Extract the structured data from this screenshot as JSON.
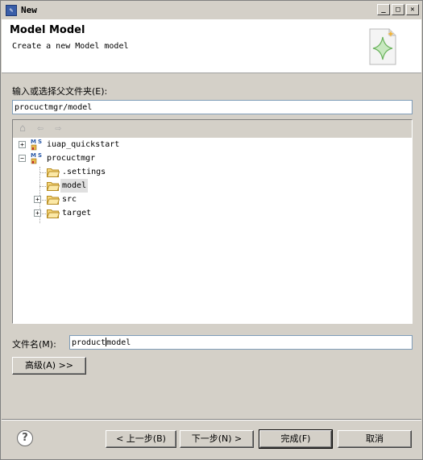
{
  "window": {
    "title": "New",
    "icon": "new-wizard-icon",
    "controls": {
      "minimize": "_",
      "maximize": "□",
      "close": "✕"
    }
  },
  "header": {
    "title": "Model Model",
    "description": "Create a new Model model",
    "icon": "wizard-banner-icon"
  },
  "folder": {
    "label": "输入或选择父文件夹(E):",
    "value": "procuctmgr/model"
  },
  "tree": {
    "toolbar": {
      "home_icon": "home-icon",
      "back_icon": "back-arrow-icon",
      "forward_icon": "forward-arrow-icon"
    },
    "nodes": [
      {
        "label": "iuap_quickstart",
        "type": "project",
        "expander": "+"
      },
      {
        "label": "procuctmgr",
        "type": "project",
        "expander": "−"
      },
      {
        "label": ".settings",
        "type": "folder"
      },
      {
        "label": "model",
        "type": "folder",
        "selected": true
      },
      {
        "label": "src",
        "type": "folder",
        "expander": "+"
      },
      {
        "label": "target",
        "type": "folder",
        "expander": "+"
      }
    ]
  },
  "file": {
    "label": "文件名(M):",
    "value_before_caret": "product",
    "value_after_caret": "model"
  },
  "advanced_button": "高级(A) >>",
  "footer": {
    "help": "?",
    "back": "< 上一步(B)",
    "next": "下一步(N) >",
    "finish": "完成(F)",
    "cancel": "取消"
  },
  "colors": {
    "dialog_bg": "#d4d0c8",
    "input_border": "#7f9db9",
    "folder": "#f3c85c"
  }
}
